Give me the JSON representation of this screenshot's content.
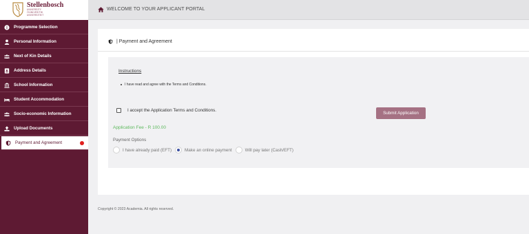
{
  "logo": {
    "name": "Stellenbosch",
    "sub_lines": [
      "UNIVERSITY",
      "IYUNIVESITHI",
      "UNIVERSITEIT"
    ]
  },
  "topbar": {
    "icon": "home-icon",
    "title": "WELCOME TO YOUR APPLICANT PORTAL"
  },
  "sidebar": {
    "items": [
      {
        "label": "Programme Selection",
        "icon": "info-circle-icon"
      },
      {
        "label": "Personal Information",
        "icon": "user-icon"
      },
      {
        "label": "Next of Kin Details",
        "icon": "users-icon"
      },
      {
        "label": "Address Details",
        "icon": "address-card-icon"
      },
      {
        "label": "School Information",
        "icon": "institution-icon"
      },
      {
        "label": "Student Accommodation",
        "icon": "bed-icon"
      },
      {
        "label": "Socio-economic Information",
        "icon": "users-icon"
      },
      {
        "label": "Upload Documents",
        "icon": "upload-icon"
      },
      {
        "label": "Payment and Agreement",
        "icon": "shield-icon",
        "active": true
      }
    ],
    "active_color": "#e0201e"
  },
  "card": {
    "title": "| Payment and Agreement",
    "instructions_heading": "Instructions",
    "instruction_item": "I have read and agree with the Terms and Conditions.",
    "accept_label": "I accept the Application Terms and Conditions.",
    "accept_checked": false,
    "submit_label": "Submit Application",
    "fee_text": "Application Fee - R 100.00",
    "payment_options_label": "Payment Options",
    "payment_options": [
      {
        "label": "I have already paid (EFT)",
        "selected": false
      },
      {
        "label": "Make an online payment",
        "selected": true
      },
      {
        "label": "Will pay later (Cash/EFT)",
        "selected": false
      }
    ]
  },
  "footer": {
    "text": "Copyright © 2023 Academia. All rights reserved."
  },
  "colors": {
    "sidebar_bg": "#5e1a33",
    "fee_green": "#5cb85c",
    "submit_bg": "#a57183"
  }
}
